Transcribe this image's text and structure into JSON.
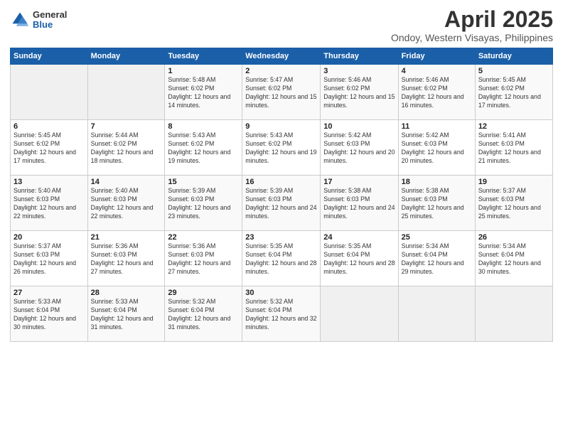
{
  "header": {
    "logo_general": "General",
    "logo_blue": "Blue",
    "title": "April 2025",
    "subtitle": "Ondoy, Western Visayas, Philippines"
  },
  "weekdays": [
    "Sunday",
    "Monday",
    "Tuesday",
    "Wednesday",
    "Thursday",
    "Friday",
    "Saturday"
  ],
  "weeks": [
    [
      {
        "day": "",
        "sunrise": "",
        "sunset": "",
        "daylight": ""
      },
      {
        "day": "",
        "sunrise": "",
        "sunset": "",
        "daylight": ""
      },
      {
        "day": "1",
        "sunrise": "Sunrise: 5:48 AM",
        "sunset": "Sunset: 6:02 PM",
        "daylight": "Daylight: 12 hours and 14 minutes."
      },
      {
        "day": "2",
        "sunrise": "Sunrise: 5:47 AM",
        "sunset": "Sunset: 6:02 PM",
        "daylight": "Daylight: 12 hours and 15 minutes."
      },
      {
        "day": "3",
        "sunrise": "Sunrise: 5:46 AM",
        "sunset": "Sunset: 6:02 PM",
        "daylight": "Daylight: 12 hours and 15 minutes."
      },
      {
        "day": "4",
        "sunrise": "Sunrise: 5:46 AM",
        "sunset": "Sunset: 6:02 PM",
        "daylight": "Daylight: 12 hours and 16 minutes."
      },
      {
        "day": "5",
        "sunrise": "Sunrise: 5:45 AM",
        "sunset": "Sunset: 6:02 PM",
        "daylight": "Daylight: 12 hours and 17 minutes."
      }
    ],
    [
      {
        "day": "6",
        "sunrise": "Sunrise: 5:45 AM",
        "sunset": "Sunset: 6:02 PM",
        "daylight": "Daylight: 12 hours and 17 minutes."
      },
      {
        "day": "7",
        "sunrise": "Sunrise: 5:44 AM",
        "sunset": "Sunset: 6:02 PM",
        "daylight": "Daylight: 12 hours and 18 minutes."
      },
      {
        "day": "8",
        "sunrise": "Sunrise: 5:43 AM",
        "sunset": "Sunset: 6:02 PM",
        "daylight": "Daylight: 12 hours and 19 minutes."
      },
      {
        "day": "9",
        "sunrise": "Sunrise: 5:43 AM",
        "sunset": "Sunset: 6:02 PM",
        "daylight": "Daylight: 12 hours and 19 minutes."
      },
      {
        "day": "10",
        "sunrise": "Sunrise: 5:42 AM",
        "sunset": "Sunset: 6:03 PM",
        "daylight": "Daylight: 12 hours and 20 minutes."
      },
      {
        "day": "11",
        "sunrise": "Sunrise: 5:42 AM",
        "sunset": "Sunset: 6:03 PM",
        "daylight": "Daylight: 12 hours and 20 minutes."
      },
      {
        "day": "12",
        "sunrise": "Sunrise: 5:41 AM",
        "sunset": "Sunset: 6:03 PM",
        "daylight": "Daylight: 12 hours and 21 minutes."
      }
    ],
    [
      {
        "day": "13",
        "sunrise": "Sunrise: 5:40 AM",
        "sunset": "Sunset: 6:03 PM",
        "daylight": "Daylight: 12 hours and 22 minutes."
      },
      {
        "day": "14",
        "sunrise": "Sunrise: 5:40 AM",
        "sunset": "Sunset: 6:03 PM",
        "daylight": "Daylight: 12 hours and 22 minutes."
      },
      {
        "day": "15",
        "sunrise": "Sunrise: 5:39 AM",
        "sunset": "Sunset: 6:03 PM",
        "daylight": "Daylight: 12 hours and 23 minutes."
      },
      {
        "day": "16",
        "sunrise": "Sunrise: 5:39 AM",
        "sunset": "Sunset: 6:03 PM",
        "daylight": "Daylight: 12 hours and 24 minutes."
      },
      {
        "day": "17",
        "sunrise": "Sunrise: 5:38 AM",
        "sunset": "Sunset: 6:03 PM",
        "daylight": "Daylight: 12 hours and 24 minutes."
      },
      {
        "day": "18",
        "sunrise": "Sunrise: 5:38 AM",
        "sunset": "Sunset: 6:03 PM",
        "daylight": "Daylight: 12 hours and 25 minutes."
      },
      {
        "day": "19",
        "sunrise": "Sunrise: 5:37 AM",
        "sunset": "Sunset: 6:03 PM",
        "daylight": "Daylight: 12 hours and 25 minutes."
      }
    ],
    [
      {
        "day": "20",
        "sunrise": "Sunrise: 5:37 AM",
        "sunset": "Sunset: 6:03 PM",
        "daylight": "Daylight: 12 hours and 26 minutes."
      },
      {
        "day": "21",
        "sunrise": "Sunrise: 5:36 AM",
        "sunset": "Sunset: 6:03 PM",
        "daylight": "Daylight: 12 hours and 27 minutes."
      },
      {
        "day": "22",
        "sunrise": "Sunrise: 5:36 AM",
        "sunset": "Sunset: 6:03 PM",
        "daylight": "Daylight: 12 hours and 27 minutes."
      },
      {
        "day": "23",
        "sunrise": "Sunrise: 5:35 AM",
        "sunset": "Sunset: 6:04 PM",
        "daylight": "Daylight: 12 hours and 28 minutes."
      },
      {
        "day": "24",
        "sunrise": "Sunrise: 5:35 AM",
        "sunset": "Sunset: 6:04 PM",
        "daylight": "Daylight: 12 hours and 28 minutes."
      },
      {
        "day": "25",
        "sunrise": "Sunrise: 5:34 AM",
        "sunset": "Sunset: 6:04 PM",
        "daylight": "Daylight: 12 hours and 29 minutes."
      },
      {
        "day": "26",
        "sunrise": "Sunrise: 5:34 AM",
        "sunset": "Sunset: 6:04 PM",
        "daylight": "Daylight: 12 hours and 30 minutes."
      }
    ],
    [
      {
        "day": "27",
        "sunrise": "Sunrise: 5:33 AM",
        "sunset": "Sunset: 6:04 PM",
        "daylight": "Daylight: 12 hours and 30 minutes."
      },
      {
        "day": "28",
        "sunrise": "Sunrise: 5:33 AM",
        "sunset": "Sunset: 6:04 PM",
        "daylight": "Daylight: 12 hours and 31 minutes."
      },
      {
        "day": "29",
        "sunrise": "Sunrise: 5:32 AM",
        "sunset": "Sunset: 6:04 PM",
        "daylight": "Daylight: 12 hours and 31 minutes."
      },
      {
        "day": "30",
        "sunrise": "Sunrise: 5:32 AM",
        "sunset": "Sunset: 6:04 PM",
        "daylight": "Daylight: 12 hours and 32 minutes."
      },
      {
        "day": "",
        "sunrise": "",
        "sunset": "",
        "daylight": ""
      },
      {
        "day": "",
        "sunrise": "",
        "sunset": "",
        "daylight": ""
      },
      {
        "day": "",
        "sunrise": "",
        "sunset": "",
        "daylight": ""
      }
    ]
  ]
}
